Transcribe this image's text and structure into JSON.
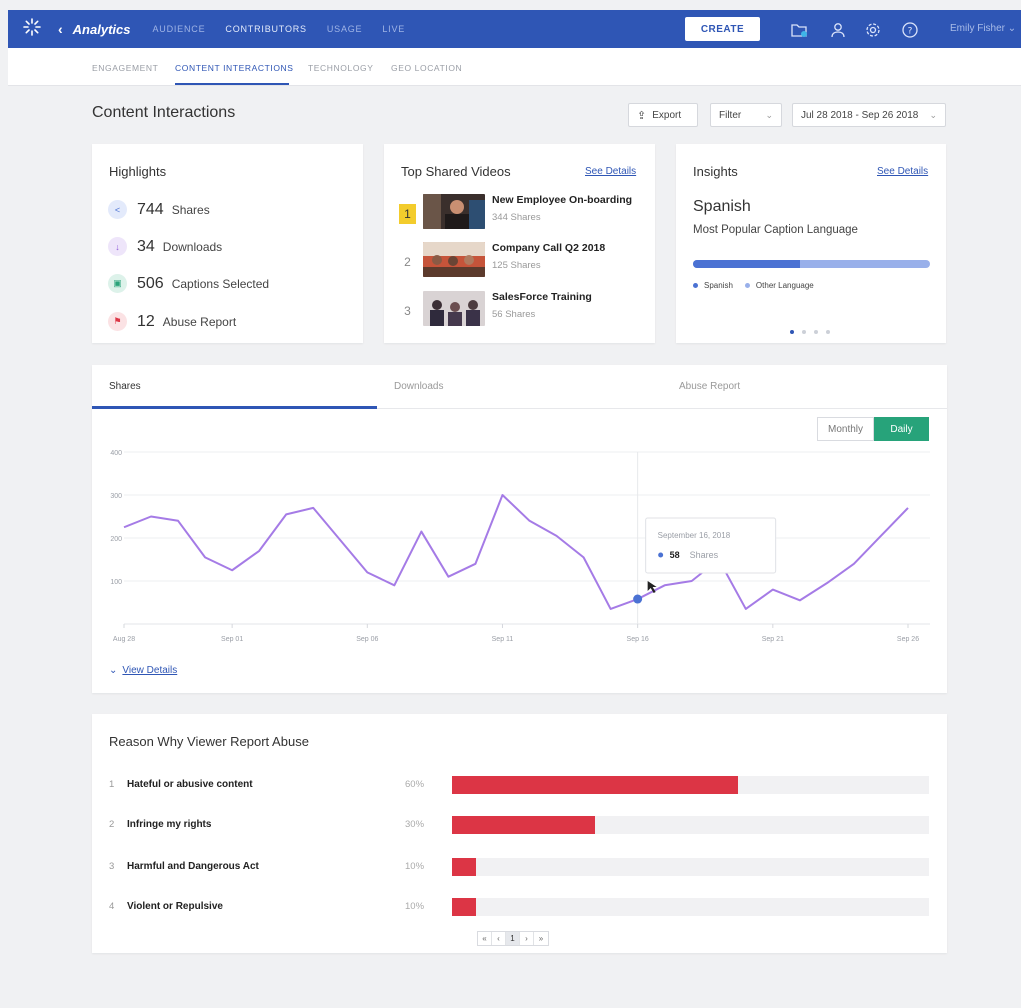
{
  "topbar": {
    "app_title": "Analytics",
    "nav": [
      "AUDIENCE",
      "CONTRIBUTORS",
      "USAGE",
      "LIVE"
    ],
    "create_label": "CREATE",
    "user_name": "Emily Fisher"
  },
  "subnav": [
    "ENGAGEMENT",
    "CONTENT INTERACTIONS",
    "TECHNOLOGY",
    "GEO LOCATION"
  ],
  "page": {
    "title": "Content Interactions",
    "export_label": "Export",
    "filter_label": "Filter",
    "date_range": "Jul 28 2018 - Sep 26 2018"
  },
  "highlights": {
    "title": "Highlights",
    "items": [
      {
        "value": "744",
        "label": "Shares",
        "color": "#4b72d3"
      },
      {
        "value": "34",
        "label": "Downloads",
        "color": "#8e5ad8"
      },
      {
        "value": "506",
        "label": "Captions Selected",
        "color": "#2aa37a"
      },
      {
        "value": "12",
        "label": "Abuse Report",
        "color": "#dc3545"
      }
    ]
  },
  "top_videos": {
    "title": "Top Shared Videos",
    "see_details": "See Details",
    "items": [
      {
        "rank": "1",
        "title": "New Employee On-boarding",
        "shares": "344 Shares"
      },
      {
        "rank": "2",
        "title": "Company Call Q2 2018",
        "shares": "125 Shares"
      },
      {
        "rank": "3",
        "title": "SalesForce Training",
        "shares": "56 Shares"
      }
    ]
  },
  "insights": {
    "title": "Insights",
    "see_details": "See Details",
    "language": "Spanish",
    "subtitle": "Most Popular Caption Language",
    "spanish_share": 0.45,
    "legend": [
      "Spanish",
      "Other Language"
    ]
  },
  "chart_tabs": [
    "Shares",
    "Downloads",
    "Abuse Report"
  ],
  "toggle": {
    "monthly": "Monthly",
    "daily": "Daily"
  },
  "view_details": "View Details",
  "chart_data": {
    "type": "line",
    "ylim": [
      0,
      400
    ],
    "y_ticks": [
      "400",
      "300",
      "200",
      "100"
    ],
    "x_tick_labels": [
      "Aug 28",
      "Sep 01",
      "Sep 06",
      "Sep 11",
      "Sep 16",
      "Sep 21",
      "Sep 26"
    ],
    "series": [
      {
        "name": "Shares",
        "color": "#a57be6",
        "values": [
          225,
          250,
          240,
          155,
          125,
          170,
          255,
          270,
          195,
          120,
          90,
          215,
          110,
          140,
          300,
          240,
          205,
          155,
          35,
          58,
          90,
          100,
          150,
          35,
          80,
          55,
          95,
          140,
          205,
          270
        ]
      }
    ],
    "tooltip": {
      "date": "September 16, 2018",
      "value": "58",
      "label": "Shares",
      "index": 19
    }
  },
  "abuse": {
    "title": "Reason Why Viewer Report Abuse",
    "items": [
      {
        "idx": "1",
        "label": "Hateful or abusive content",
        "pct_label": "60%",
        "pct": 60
      },
      {
        "idx": "2",
        "label": "Infringe my rights",
        "pct_label": "30%",
        "pct": 30
      },
      {
        "idx": "3",
        "label": "Harmful and Dangerous Act",
        "pct_label": "10%",
        "pct": 5
      },
      {
        "idx": "4",
        "label": "Violent or Repulsive",
        "pct_label": "10%",
        "pct": 5
      }
    ],
    "pagination": {
      "first": "«",
      "prev": "‹",
      "page": "1",
      "next": "›",
      "last": "»"
    }
  }
}
